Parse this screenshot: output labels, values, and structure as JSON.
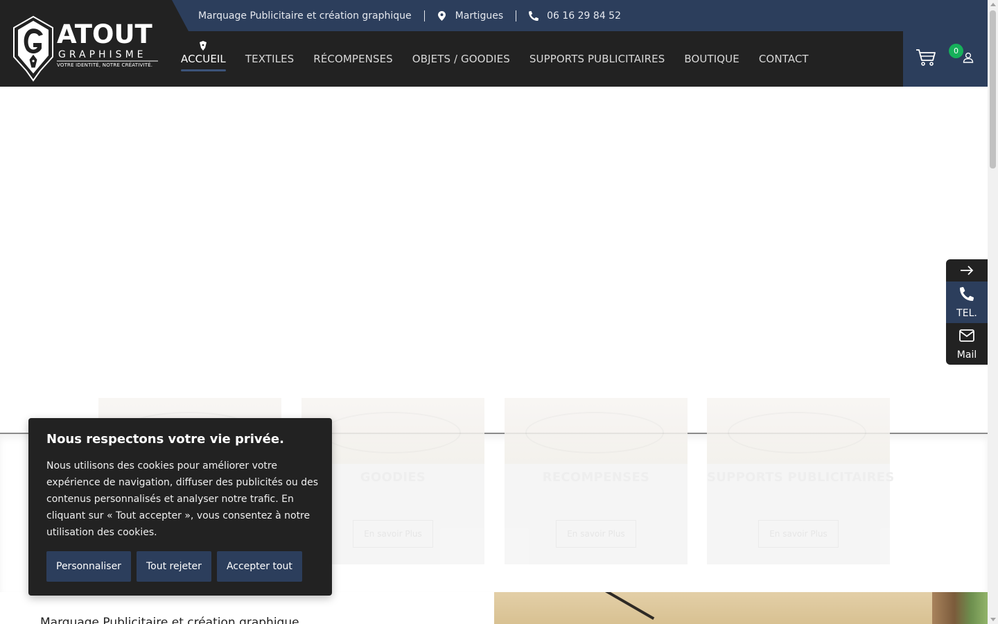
{
  "brand": {
    "logo_title": "ATOUT",
    "logo_subtitle": "GRAPHISME",
    "logo_tagline": "VOTRE IDENTITÉ, NOTRE CRÉATIVITÉ."
  },
  "topbar": {
    "tagline": "Marquage Publicitaire et création graphique",
    "location": "Martigues",
    "phone": "06 16 29 84 52",
    "location_icon": "map-pin-icon",
    "phone_icon": "phone-icon"
  },
  "nav": {
    "items": [
      {
        "label": "ACCUEIL",
        "active": true
      },
      {
        "label": "TEXTILES",
        "active": false
      },
      {
        "label": "RÉCOMPENSES",
        "active": false
      },
      {
        "label": "OBJETS / GOODIES",
        "active": false
      },
      {
        "label": "SUPPORTS PUBLICITAIRES",
        "active": false
      },
      {
        "label": "BOUTIQUE",
        "active": false
      },
      {
        "label": "CONTACT",
        "active": false
      }
    ]
  },
  "actions": {
    "cart_count": "0",
    "cart_icon": "cart-icon",
    "user_icon": "user-icon"
  },
  "cards": [
    {
      "title": "",
      "button": ""
    },
    {
      "title": "GOODIES",
      "button": "En savoir Plus"
    },
    {
      "title": "RECOMPENSES",
      "button": "En savoir Plus"
    },
    {
      "title": "SUPPORTS PUBLICITAIRES",
      "button": "En savoir Plus"
    }
  ],
  "side_contact": {
    "tel_label": "TEL.",
    "mail_label": "Mail",
    "arrow_icon": "arrow-right-icon"
  },
  "cookie": {
    "title": "Nous respectons votre vie privée.",
    "text": "Nous utilisons des cookies pour améliorer votre expérience de navigation, diffuser des publicités ou des contenus personnalisés et analyser notre trafic. En cliquant sur « Tout accepter », vous consentez à notre utilisation des cookies.",
    "btn_customize": "Personnaliser",
    "btn_reject": "Tout rejeter",
    "btn_accept": "Accepter tout"
  },
  "bottom": {
    "heading": "Marquage Publicitaire et création graphique"
  },
  "colors": {
    "dark": "#222222",
    "navy": "#2c3e5c",
    "badge_green": "#16b05a"
  }
}
